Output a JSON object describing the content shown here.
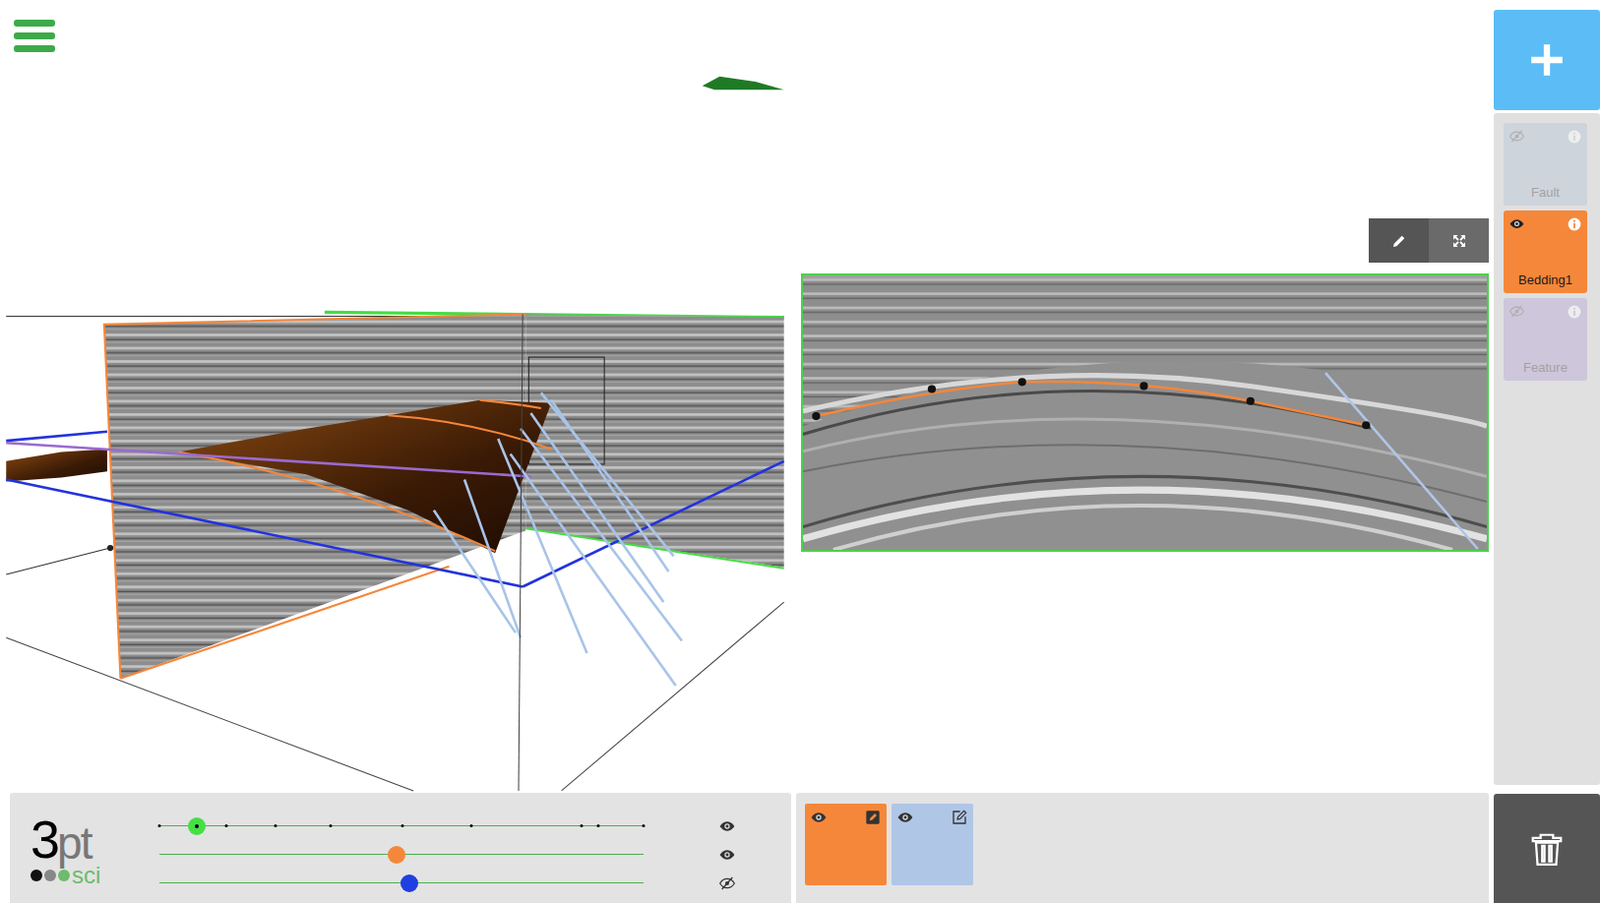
{
  "logo": {
    "main": "3",
    "accent": "pt",
    "sub": "sci"
  },
  "layers": [
    {
      "label": "Fault",
      "visible": false,
      "selected": false,
      "color": "#b9c6d8"
    },
    {
      "label": "Bedding1",
      "visible": true,
      "selected": true,
      "color": "#f5873a"
    },
    {
      "label": "Feature",
      "visible": false,
      "selected": false,
      "color": "#b9a8d4"
    }
  ],
  "sliders": [
    {
      "kind": "stepped",
      "level": 0.077,
      "color": "#44e044",
      "visible": true,
      "ticks": [
        0,
        0.139,
        0.239,
        0.353,
        0.501,
        0.643,
        0.871,
        0.906,
        1
      ]
    },
    {
      "kind": "continuous",
      "level": 0.49,
      "color": "#f5873a",
      "visible": true
    },
    {
      "kind": "continuous",
      "level": 0.516,
      "color": "#1f3fe0",
      "visible": false
    }
  ],
  "section_layers": [
    {
      "color": "#f5873a",
      "visible": true,
      "editing": true
    },
    {
      "color": "#b0c6e6",
      "visible": true,
      "editing": false
    }
  ]
}
